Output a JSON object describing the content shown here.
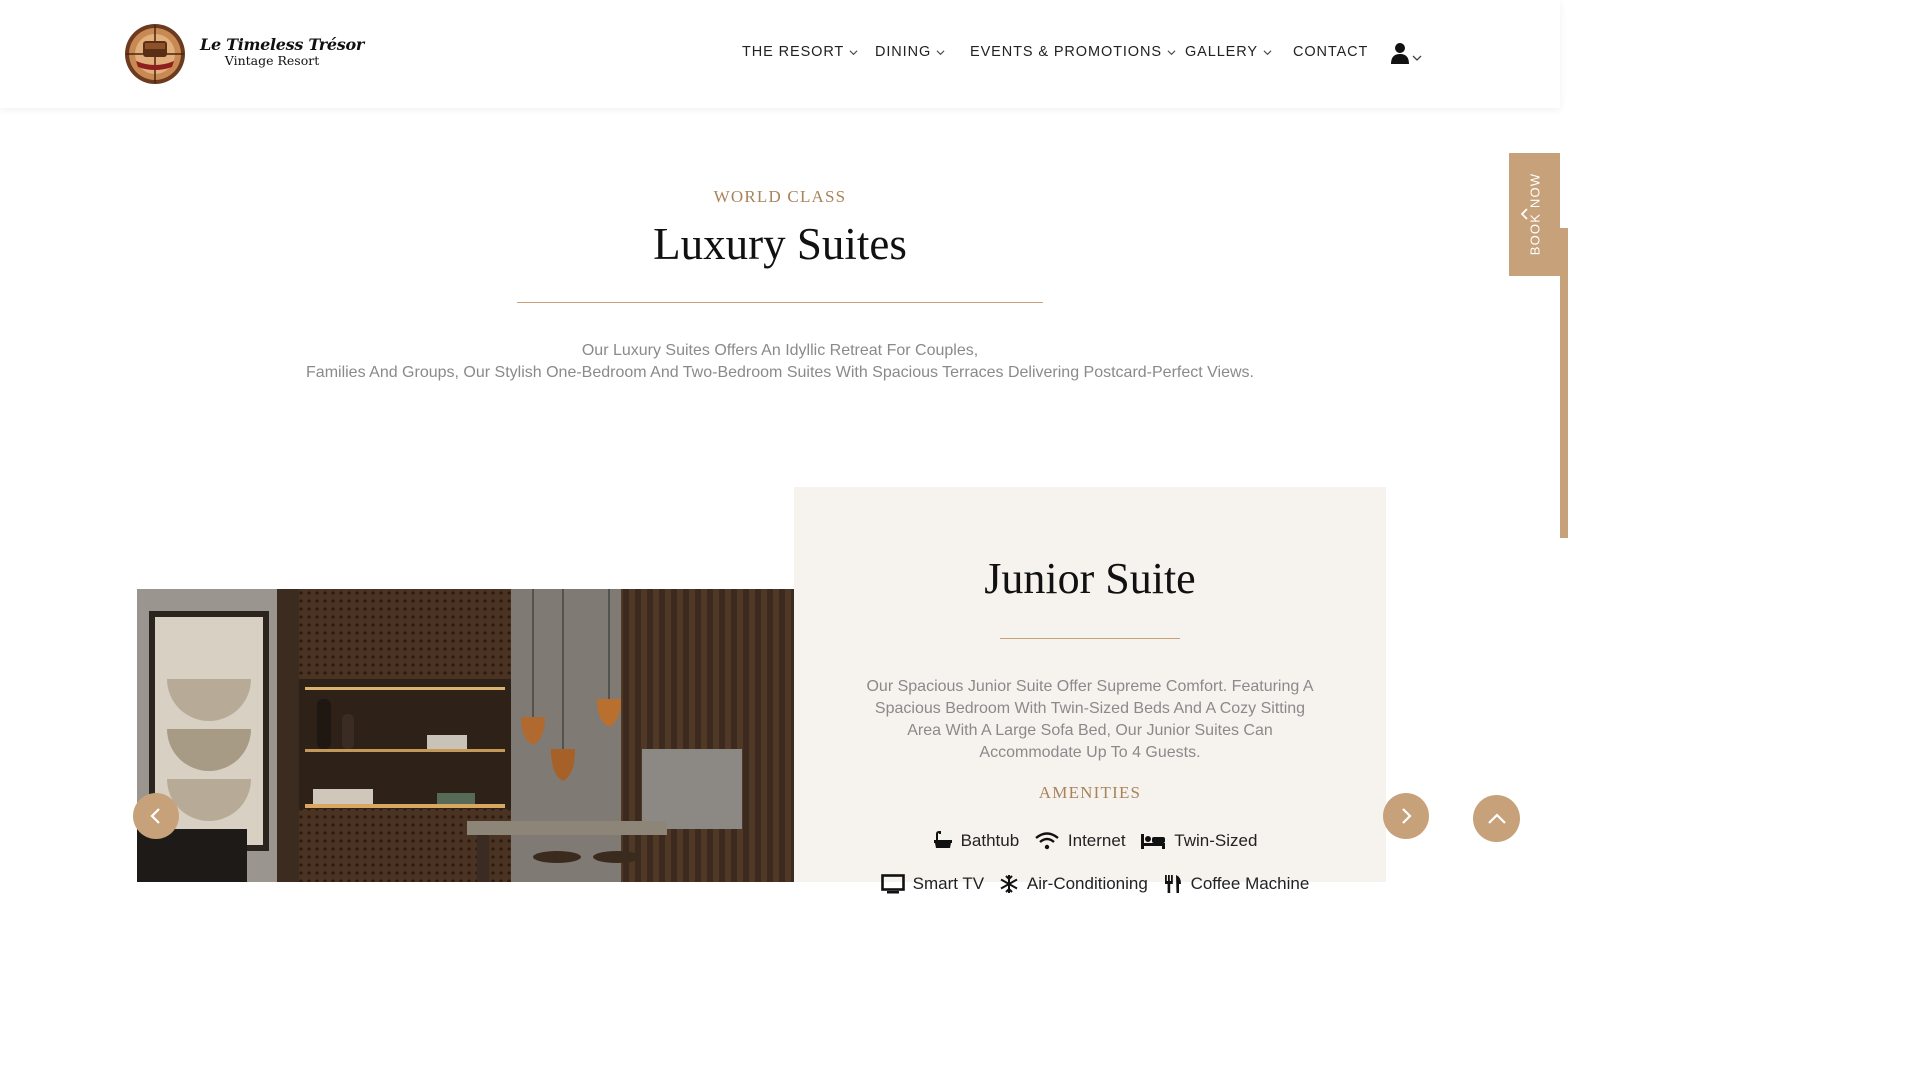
{
  "brand": {
    "name": "Le Timeless Trésor",
    "subtitle": "Vintage Resort"
  },
  "nav": {
    "items": [
      {
        "label": "THE RESORT",
        "dropdown": true
      },
      {
        "label": "DINING",
        "dropdown": true
      },
      {
        "label": "EVENTS & PROMOTIONS",
        "dropdown": true
      },
      {
        "label": "GALLERY",
        "dropdown": true
      },
      {
        "label": "CONTACT",
        "dropdown": false
      }
    ],
    "user_icon": "user-icon"
  },
  "intro": {
    "eyebrow": "WORLD CLASS",
    "title": "Luxury Suites",
    "line1": "Our Luxury Suites Offers An Idyllic Retreat For Couples,",
    "line2": "Families And Groups, Our Stylish One-Bedroom And Two-Bedroom Suites With Spacious Terraces Delivering Postcard-Perfect Views."
  },
  "book_now": {
    "label": "BOOK NOW"
  },
  "suite": {
    "title": "Junior Suite",
    "description": "Our Spacious Junior Suite Offer Supreme Comfort. Featuring A Spacious Bedroom With Twin-Sized Beds And A Cozy Sitting Area With A Large Sofa Bed, Our Junior Suites Can Accommodate Up To 4 Guests.",
    "amenities_heading": "AMENITIES",
    "amenities": [
      {
        "icon": "bathtub-icon",
        "label": "Bathtub"
      },
      {
        "icon": "wifi-icon",
        "label": "Internet"
      },
      {
        "icon": "bed-icon",
        "label": "Twin-Sized"
      },
      {
        "icon": "tv-icon",
        "label": "Smart TV"
      },
      {
        "icon": "snowflake-icon",
        "label": "Air-Conditioning"
      },
      {
        "icon": "utensils-icon",
        "label": "Coffee Machine"
      }
    ]
  },
  "colors": {
    "accent": "#c7a17a",
    "card_bg": "#f6f3ef",
    "muted_text": "#8a8a8a"
  }
}
